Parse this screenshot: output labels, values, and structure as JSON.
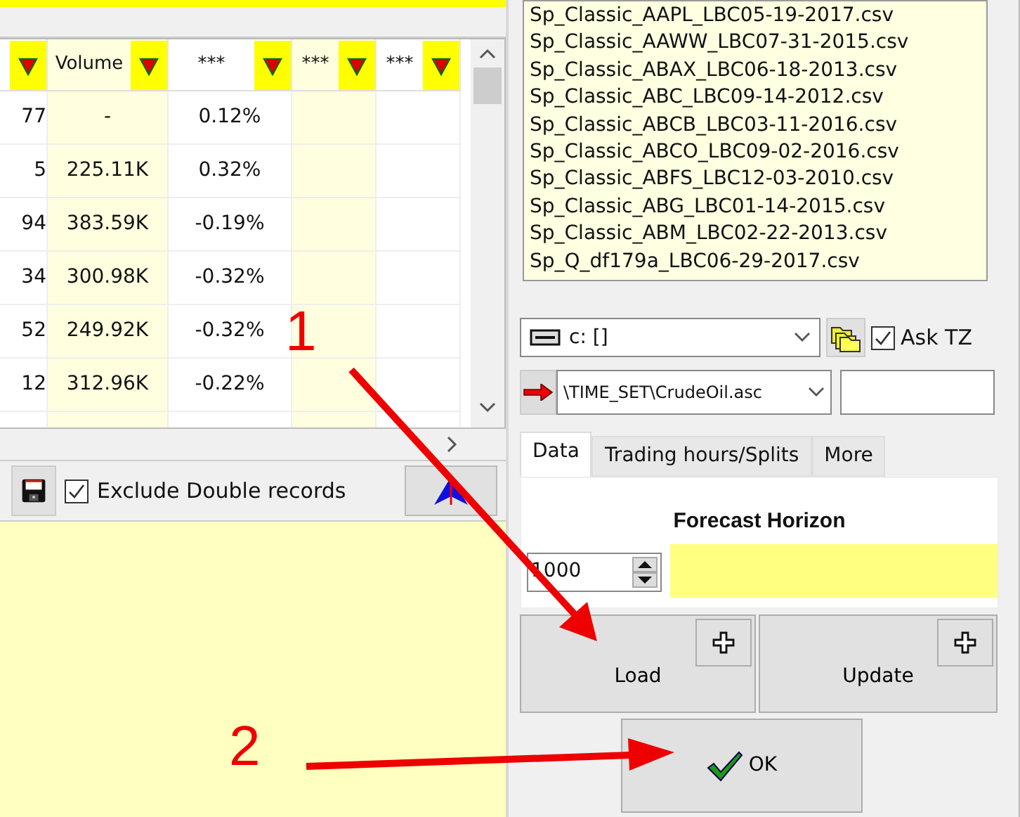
{
  "table": {
    "columns": [
      {
        "filter": true,
        "highlighted": false
      },
      {
        "label": "Volume",
        "filter": true,
        "highlighted": true
      },
      {
        "label": "***",
        "filter": true,
        "highlighted": false
      },
      {
        "label": "***",
        "filter": true,
        "highlighted": true
      },
      {
        "label": "***",
        "filter": true,
        "highlighted": false
      }
    ],
    "rows": [
      [
        "77",
        "-",
        "0.12%",
        "",
        ""
      ],
      [
        "5",
        "225.11K",
        "0.32%",
        "",
        ""
      ],
      [
        "94",
        "383.59K",
        "-0.19%",
        "",
        ""
      ],
      [
        "34",
        "300.98K",
        "-0.32%",
        "",
        ""
      ],
      [
        "52",
        "249.92K",
        "-0.32%",
        "",
        ""
      ],
      [
        "12",
        "312.96K",
        "-0.22%",
        "",
        ""
      ],
      [
        "",
        "",
        "",
        "",
        ""
      ]
    ]
  },
  "toolbar": {
    "exclude_double_records": {
      "label": "Exclude Double records",
      "checked": true
    }
  },
  "files": [
    "Sp_Classic_AAPL_LBC05-19-2017.csv",
    "Sp_Classic_AAWW_LBC07-31-2015.csv",
    "Sp_Classic_ABAX_LBC06-18-2013.csv",
    "Sp_Classic_ABC_LBC09-14-2012.csv",
    "Sp_Classic_ABCB_LBC03-11-2016.csv",
    "Sp_Classic_ABCO_LBC09-02-2016.csv",
    "Sp_Classic_ABFS_LBC12-03-2010.csv",
    "Sp_Classic_ABG_LBC01-14-2015.csv",
    "Sp_Classic_ABM_LBC02-22-2013.csv",
    "Sp_Q_df179a_LBC06-29-2017.csv"
  ],
  "drive": {
    "value": "c: []"
  },
  "ask_tz": {
    "label": "Ask TZ",
    "checked": true
  },
  "path": {
    "value": "\\TIME_SET\\CrudeOil.asc"
  },
  "tabs": [
    {
      "label": "Data",
      "selected": true
    },
    {
      "label": "Trading hours/Splits",
      "selected": false
    },
    {
      "label": "More",
      "selected": false
    }
  ],
  "forecast": {
    "title": "Forecast Horizon",
    "value": "1000"
  },
  "buttons": {
    "load": "Load",
    "update": "Update",
    "ok": "OK"
  },
  "annotations": [
    {
      "label": "1"
    },
    {
      "label": "2"
    }
  ]
}
